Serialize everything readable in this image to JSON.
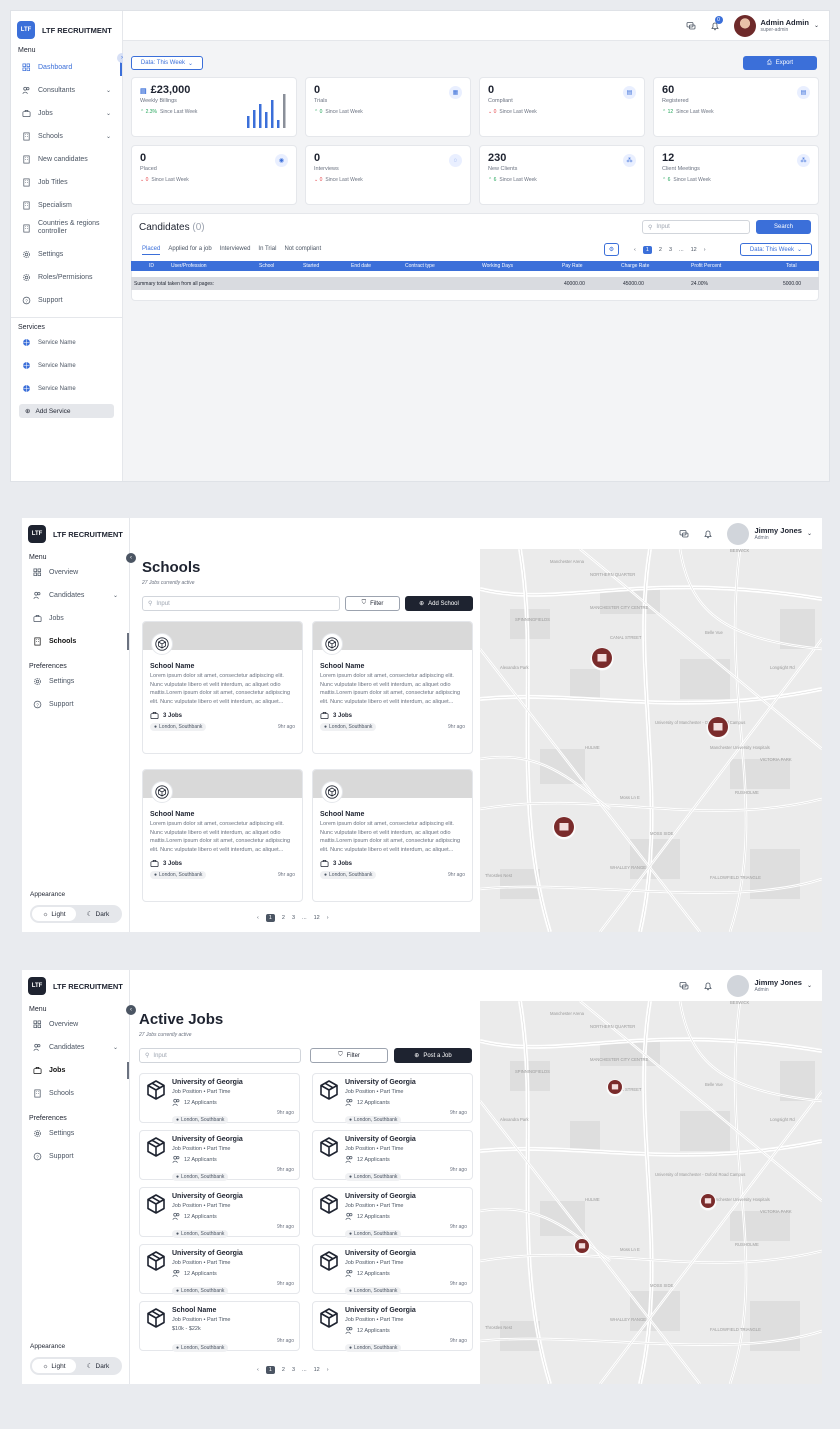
{
  "colors": {
    "primary": "#3b6fd9",
    "dark": "#1e2330",
    "up": "#22a559",
    "down": "#e5484d"
  },
  "brand": "LTF RECRUITMENT",
  "logo_text": "LTF",
  "screen1": {
    "user": {
      "name": "Admin Admin",
      "role": "super-admin",
      "notifications": "0"
    },
    "menu_label": "Menu",
    "nav": [
      "Dashboard",
      "Consultants",
      "Jobs",
      "Schools",
      "New candidates",
      "Job Titles",
      "Specialism",
      "Countries & regions controller",
      "Settings",
      "Roles/Permisions",
      "Support"
    ],
    "services_label": "Services",
    "services": [
      "Service Name",
      "Service Name",
      "Service Name"
    ],
    "add_service": "Add Service",
    "date_filter": "Data: This Week",
    "export": "Export",
    "kpis": [
      {
        "value": "£23,000",
        "label": "Weekly Billings",
        "delta": "2.3%",
        "since": "Since Last Week",
        "dir": "up"
      },
      {
        "value": "0",
        "label": "Trials",
        "delta": "0",
        "since": "Since Last Week",
        "dir": "up"
      },
      {
        "value": "0",
        "label": "Compliant",
        "delta": "0",
        "since": "Since Last Week",
        "dir": "down"
      },
      {
        "value": "60",
        "label": "Registered",
        "delta": "12",
        "since": "Since Last Week",
        "dir": "up"
      },
      {
        "value": "0",
        "label": "Placed",
        "delta": "0",
        "since": "Since Last Week",
        "dir": "down"
      },
      {
        "value": "0",
        "label": "Interviews",
        "delta": "0",
        "since": "Since Last Week",
        "dir": "down"
      },
      {
        "value": "230",
        "label": "New Clients",
        "delta": "6",
        "since": "Since Last Week",
        "dir": "up"
      },
      {
        "value": "12",
        "label": "Client Meetings",
        "delta": "6",
        "since": "Since Last Week",
        "dir": "up"
      }
    ],
    "candidates_title": "Candidates",
    "candidates_count": "(0)",
    "search_placeholder": "Input",
    "search_button": "Search",
    "tabs": [
      "Placed",
      "Applied for a job",
      "Interviewed",
      "In Trial",
      "Not compliant"
    ],
    "pager": [
      "1",
      "2",
      "3",
      "...",
      "12"
    ],
    "table_headers": [
      "ID",
      "User/Profession",
      "School",
      "Started",
      "End date",
      "Contract type",
      "Working Days",
      "Pay Rate",
      "Charge Rate",
      "Profit Percent",
      "Total"
    ],
    "summary": {
      "label": "Summary total taken from all pages:",
      "pay_rate": "40000.00",
      "charge_rate": "45000.00",
      "profit_percent": "24.00%",
      "total": "5000.00"
    }
  },
  "screen2": {
    "user": {
      "name": "Jimmy Jones",
      "role": "Admin"
    },
    "menu_label": "Menu",
    "nav": [
      "Overview",
      "Candidates",
      "Jobs",
      "Schools"
    ],
    "preferences_label": "Preferences",
    "prefs": [
      "Settings",
      "Support"
    ],
    "title": "Schools",
    "subtitle": "27 Jobs currently active",
    "search_placeholder": "Input",
    "filter": "Filter",
    "add": "Add School",
    "cards": [
      {
        "name": "School Name",
        "desc": "Lorem ipsum dolor sit amet, consectetur adipiscing elit. Nunc vulputate libero et velit interdum, ac aliquet odio mattis.Lorem ipsum dolor sit amet, consectetur adipiscing elit. Nunc vulputate libero et velit interdum, ac aliquet...",
        "jobs": "3 Jobs",
        "location": "London, Southbank",
        "ago": "9hr ago"
      },
      {
        "name": "School Name",
        "desc": "Lorem ipsum dolor sit amet, consectetur adipiscing elit. Nunc vulputate libero et velit interdum, ac aliquet odio mattis.Lorem ipsum dolor sit amet, consectetur adipiscing elit. Nunc vulputate libero et velit interdum, ac aliquet...",
        "jobs": "3 Jobs",
        "location": "London, Southbank",
        "ago": "9hr ago"
      },
      {
        "name": "School Name",
        "desc": "Lorem ipsum dolor sit amet, consectetur adipiscing elit. Nunc vulputate libero et velit interdum, ac aliquet odio mattis.Lorem ipsum dolor sit amet, consectetur adipiscing elit. Nunc vulputate libero et velit interdum, ac aliquet...",
        "jobs": "3 Jobs",
        "location": "London, Southbank",
        "ago": "9hr ago"
      },
      {
        "name": "School Name",
        "desc": "Lorem ipsum dolor sit amet, consectetur adipiscing elit. Nunc vulputate libero et velit interdum, ac aliquet odio mattis.Lorem ipsum dolor sit amet, consectetur adipiscing elit. Nunc vulputate libero et velit interdum, ac aliquet...",
        "jobs": "3 Jobs",
        "location": "London, Southbank",
        "ago": "9hr ago"
      }
    ],
    "pager": [
      "1",
      "2",
      "3",
      "...",
      "12"
    ],
    "appearance_label": "Appearance",
    "light": "Light",
    "dark": "Dark"
  },
  "screen3": {
    "user": {
      "name": "Jimmy Jones",
      "role": "Admin"
    },
    "menu_label": "Menu",
    "nav": [
      "Overview",
      "Candidates",
      "Jobs",
      "Schools"
    ],
    "preferences_label": "Preferences",
    "prefs": [
      "Settings",
      "Support"
    ],
    "title": "Active Jobs",
    "subtitle": "27 Jobs currently active",
    "search_placeholder": "Input",
    "filter": "Filter",
    "add": "Post a Job",
    "jobs": [
      {
        "name": "University of Georgia",
        "position": "Job Position • Part Time",
        "extra": "12 Applicants",
        "location": "London, Southbank",
        "ago": "9hr ago"
      },
      {
        "name": "University of Georgia",
        "position": "Job Position • Part Time",
        "extra": "12 Applicants",
        "location": "London, Southbank",
        "ago": "9hr ago"
      },
      {
        "name": "University of Georgia",
        "position": "Job Position • Part Time",
        "extra": "12 Applicants",
        "location": "London, Southbank",
        "ago": "9hr ago"
      },
      {
        "name": "University of Georgia",
        "position": "Job Position • Part Time",
        "extra": "12 Applicants",
        "location": "London, Southbank",
        "ago": "9hr ago"
      },
      {
        "name": "University of Georgia",
        "position": "Job Position • Part Time",
        "extra": "12 Applicants",
        "location": "London, Southbank",
        "ago": "9hr ago"
      },
      {
        "name": "University of Georgia",
        "position": "Job Position • Part Time",
        "extra": "12 Applicants",
        "location": "London, Southbank",
        "ago": "9hr ago"
      },
      {
        "name": "University of Georgia",
        "position": "Job Position • Part Time",
        "extra": "12 Applicants",
        "location": "London, Southbank",
        "ago": "9hr ago"
      },
      {
        "name": "University of Georgia",
        "position": "Job Position • Part Time",
        "extra": "12 Applicants",
        "location": "London, Southbank",
        "ago": "9hr ago"
      },
      {
        "name": "School Name",
        "position": "Job Position • Part Time",
        "extra": "$10k - $22k",
        "location": "London, Southbank",
        "ago": "9hr ago"
      },
      {
        "name": "University of Georgia",
        "position": "Job Position • Part Time",
        "extra": "12 Applicants",
        "location": "London, Southbank",
        "ago": "9hr ago"
      }
    ],
    "pager": [
      "1",
      "2",
      "3",
      "...",
      "12"
    ],
    "appearance_label": "Appearance",
    "light": "Light",
    "dark": "Dark"
  },
  "map_labels": [
    "Manchester Arena",
    "NORTHERN QUARTER",
    "MANCHESTER CITY CENTRE",
    "SPINNINGFIELDS",
    "CANAL STREET",
    "University of Manchester - Oxford Road Campus",
    "Manchester University Hospitals",
    "VICTORIA PARK",
    "RUSHOLME",
    "MOSS SIDE",
    "Moss Ln E",
    "FALLOWFIELD TRIANGLE",
    "WHALLEY RANGE",
    "HULME",
    "Alexandra Park",
    "Throstles Nest",
    "BESWICK",
    "Belle Vue",
    "Longsight Rd"
  ]
}
